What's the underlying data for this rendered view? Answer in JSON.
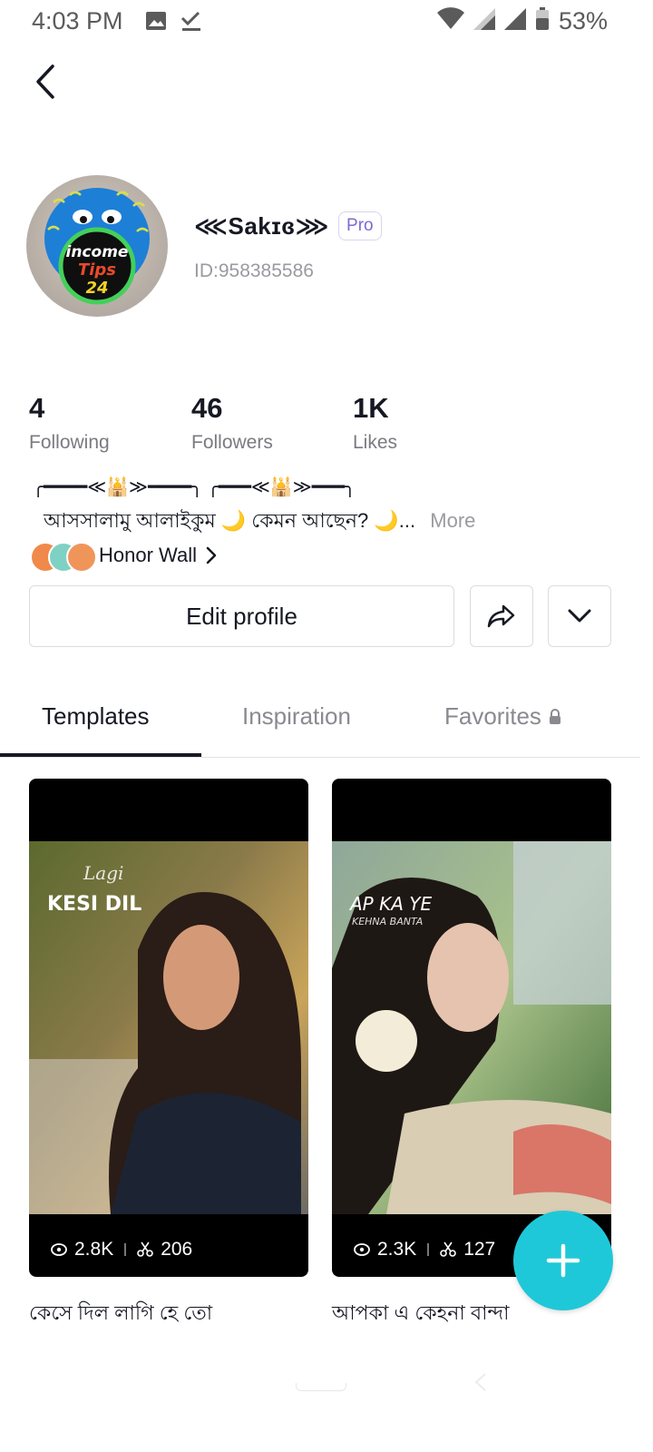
{
  "status_bar": {
    "time": "4:03 PM",
    "battery": "53%"
  },
  "profile": {
    "username": "⋘Sakɪɞ⋙",
    "pro_label": "Pro",
    "id": "ID:958385586",
    "bio_decoration": "╭━━━━≪🕌≫━━━━╮ ╭━━━≪🕌≫━━━╮",
    "bio": "আসসালামু আলাইকুম 🌙 কেমন আছেন? 🌙...",
    "bio_more": "More",
    "honor_wall": "Honor Wall"
  },
  "stats": [
    {
      "value": "4",
      "label": "Following"
    },
    {
      "value": "46",
      "label": "Followers"
    },
    {
      "value": "1K",
      "label": "Likes"
    }
  ],
  "buttons": {
    "edit_profile": "Edit profile"
  },
  "tabs": [
    {
      "label": "Templates",
      "active": true
    },
    {
      "label": "Inspiration",
      "active": false
    },
    {
      "label": "Favorites",
      "active": false
    }
  ],
  "cards": [
    {
      "views": "2.8K",
      "uses": "206",
      "title": "কেসে দিল লাগি হে তো",
      "overlay_line1": "Lagi",
      "overlay_line2": "KESI DIL"
    },
    {
      "views": "2.3K",
      "uses": "127",
      "title": "আপকা এ কেহনা বান্দা",
      "overlay_line1": "AP KA YE",
      "overlay_line2": "KEHNA BANTA"
    }
  ],
  "colors": {
    "accent": "#1fc8d8",
    "pro": "#7b6bd0",
    "text": "#161823",
    "muted": "#8a8a90"
  }
}
